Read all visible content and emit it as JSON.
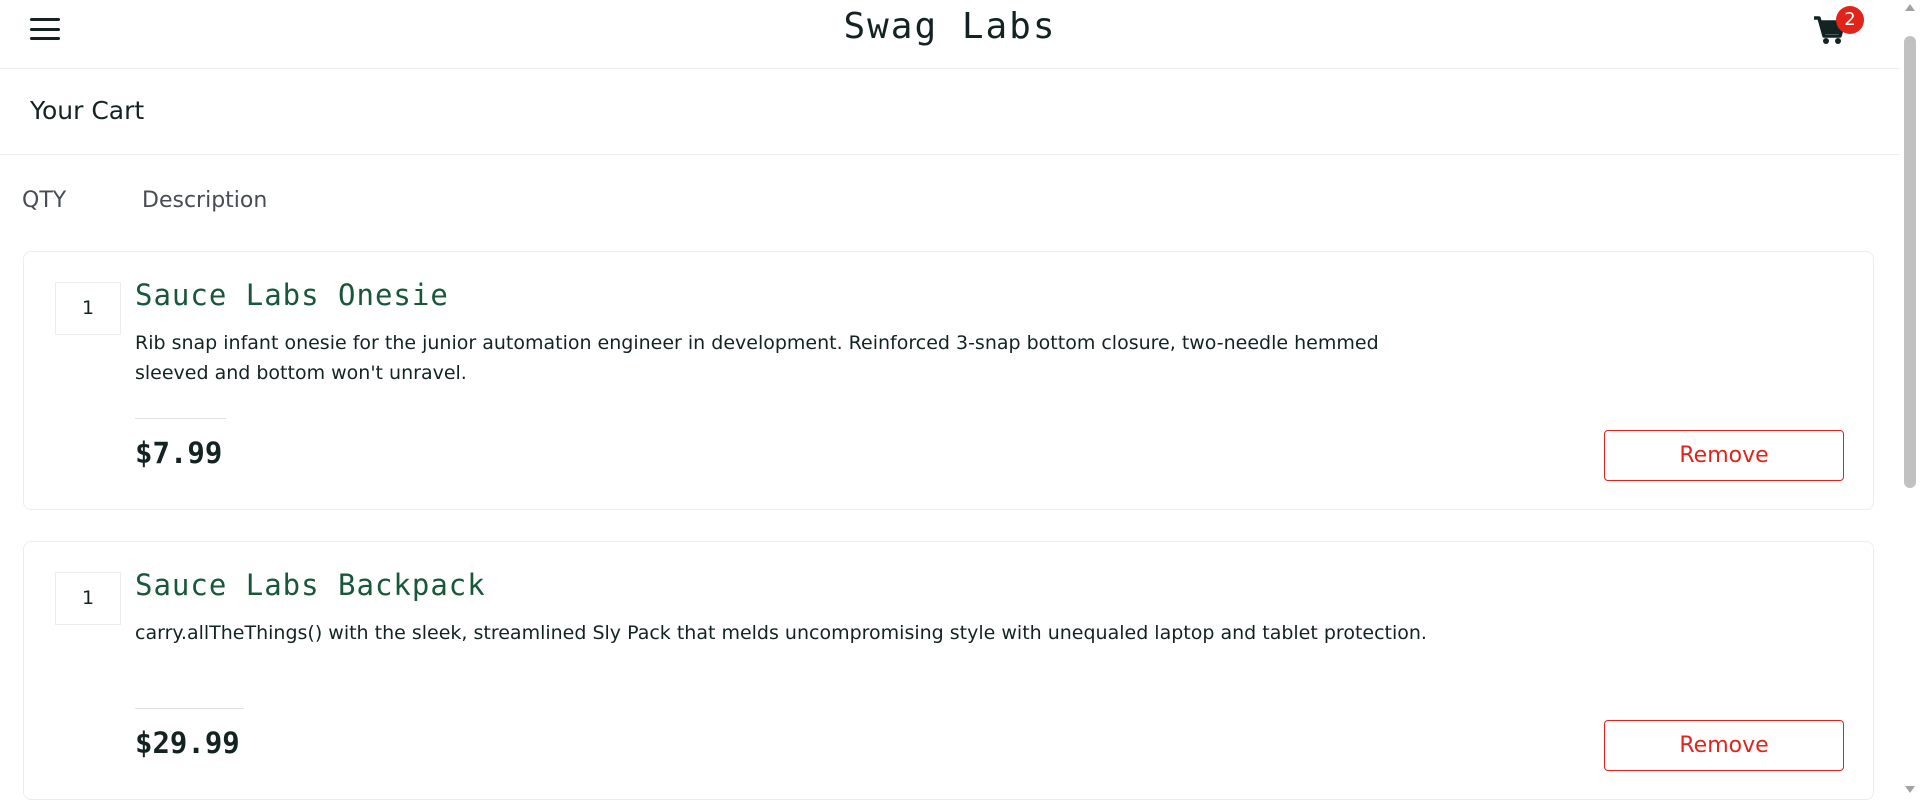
{
  "header": {
    "title": "Swag Labs",
    "cart_count": "2"
  },
  "page": {
    "title": "Your Cart"
  },
  "columns": {
    "qty": "QTY",
    "description": "Description"
  },
  "items": [
    {
      "qty": "1",
      "name": "Sauce Labs Onesie",
      "description": "Rib snap infant onesie for the junior automation engineer in development. Reinforced 3-snap bottom closure, two-needle hemmed sleeved and bottom won't unravel.",
      "price": "$7.99",
      "remove_label": "Remove"
    },
    {
      "qty": "1",
      "name": "Sauce Labs Backpack",
      "description": "carry.allTheThings() with the sleek, streamlined Sly Pack that melds uncompromising style with unequaled laptop and tablet protection.",
      "price": "$29.99",
      "remove_label": "Remove"
    }
  ],
  "icons": {
    "menu": "hamburger-menu-icon",
    "cart": "shopping-cart-icon"
  },
  "colors": {
    "item_title": "#18583a",
    "remove": "#e2231a",
    "badge": "#e2231a",
    "text": "#132322"
  }
}
